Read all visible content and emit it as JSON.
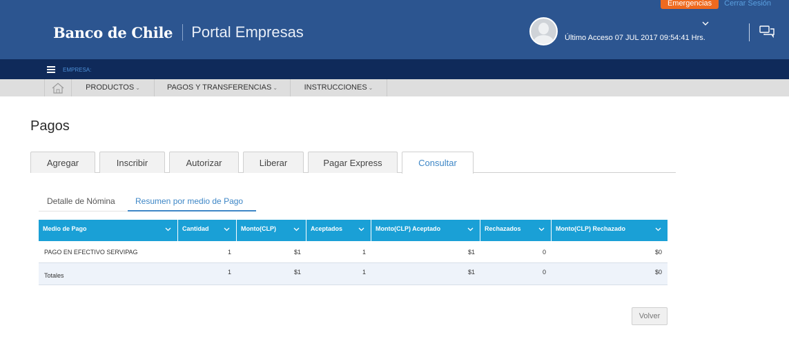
{
  "header": {
    "emergency_label": "Emergencias",
    "logout_label": "Cerrar Sesión",
    "bank_name": "Banco de Chile",
    "portal_name": "Portal Empresas",
    "last_access": "Último Acceso 07 JUL 2017 09:54:41 Hrs."
  },
  "company_bar": {
    "label": "EMPRESA:"
  },
  "nav": {
    "items": [
      {
        "label": "PRODUCTOS"
      },
      {
        "label": "PAGOS Y TRANSFERENCIAS"
      },
      {
        "label": "INSTRUCCIONES"
      }
    ]
  },
  "page": {
    "title": "Pagos"
  },
  "tabs": [
    {
      "label": "Agregar"
    },
    {
      "label": "Inscribir"
    },
    {
      "label": "Autorizar"
    },
    {
      "label": "Liberar"
    },
    {
      "label": "Pagar Express"
    },
    {
      "label": "Consultar"
    }
  ],
  "subtabs": [
    {
      "label": "Detalle de Nómina"
    },
    {
      "label": "Resumen por medio de Pago"
    }
  ],
  "table": {
    "columns": [
      "Medio de Pago",
      "Cantidad",
      "Monto(CLP)",
      "Aceptados",
      "Monto(CLP) Aceptado",
      "Rechazados",
      "Monto(CLP) Rechazado"
    ],
    "rows": [
      [
        "PAGO EN EFECTIVO SERVIPAG",
        "1",
        "$1",
        "1",
        "$1",
        "0",
        "$0"
      ],
      [
        "Totales",
        "1",
        "$1",
        "1",
        "$1",
        "0",
        "$0"
      ]
    ]
  },
  "footer": {
    "back_label": "Volver"
  },
  "colors": {
    "header_bg": "#2c5590",
    "company_bar_bg": "#0f2a5a",
    "emergency": "#ef6a1f",
    "table_header": "#1aa0d6",
    "accent": "#3d86c6"
  }
}
